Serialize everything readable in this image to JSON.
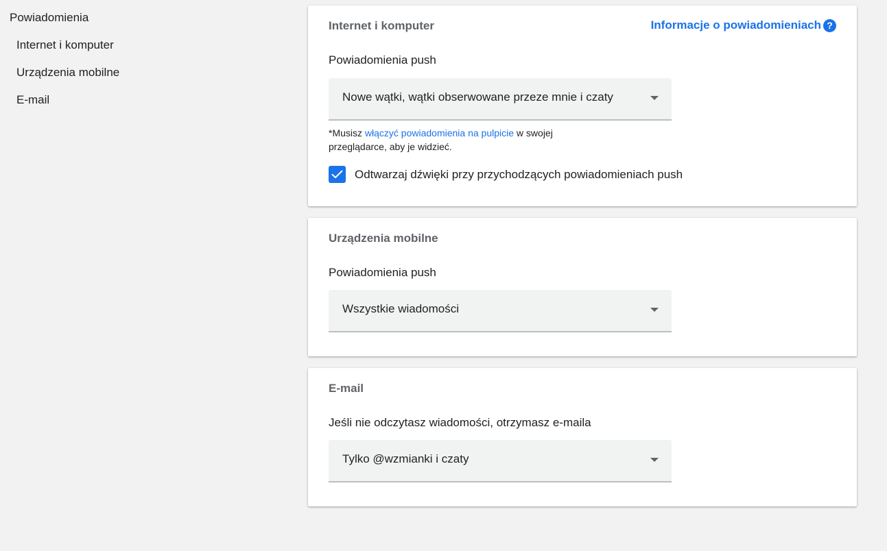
{
  "nav": {
    "title": "Powiadomienia",
    "items": [
      {
        "label": "Internet i komputer"
      },
      {
        "label": "Urządzenia mobilne"
      },
      {
        "label": "E-mail"
      }
    ]
  },
  "desktop": {
    "title": "Internet i komputer",
    "info_link": "Informacje o powiadomieniach",
    "push_label": "Powiadomienia push",
    "push_value": "Nowe wątki, wątki obserwowane przeze mnie i czaty",
    "note_prefix": "*Musisz ",
    "note_link": "włączyć powiadomienia na pulpicie",
    "note_suffix": " w swojej przeglądarce, aby je widzieć.",
    "sound_label": "Odtwarzaj dźwięki przy przychodzących powiadomieniach push",
    "sound_checked": true
  },
  "mobile": {
    "title": "Urządzenia mobilne",
    "push_label": "Powiadomienia push",
    "push_value": "Wszystkie wiadomości"
  },
  "email": {
    "title": "E-mail",
    "label": "Jeśli nie odczytasz wiadomości, otrzymasz e-maila",
    "value": "Tylko @wzmianki i czaty"
  },
  "colors": {
    "accent": "#1a73e8",
    "background": "#f2f2f2",
    "select_bg": "#f1f3f3"
  },
  "icons": [
    "help-icon",
    "dropdown-arrow-icon",
    "checkmark-icon"
  ]
}
